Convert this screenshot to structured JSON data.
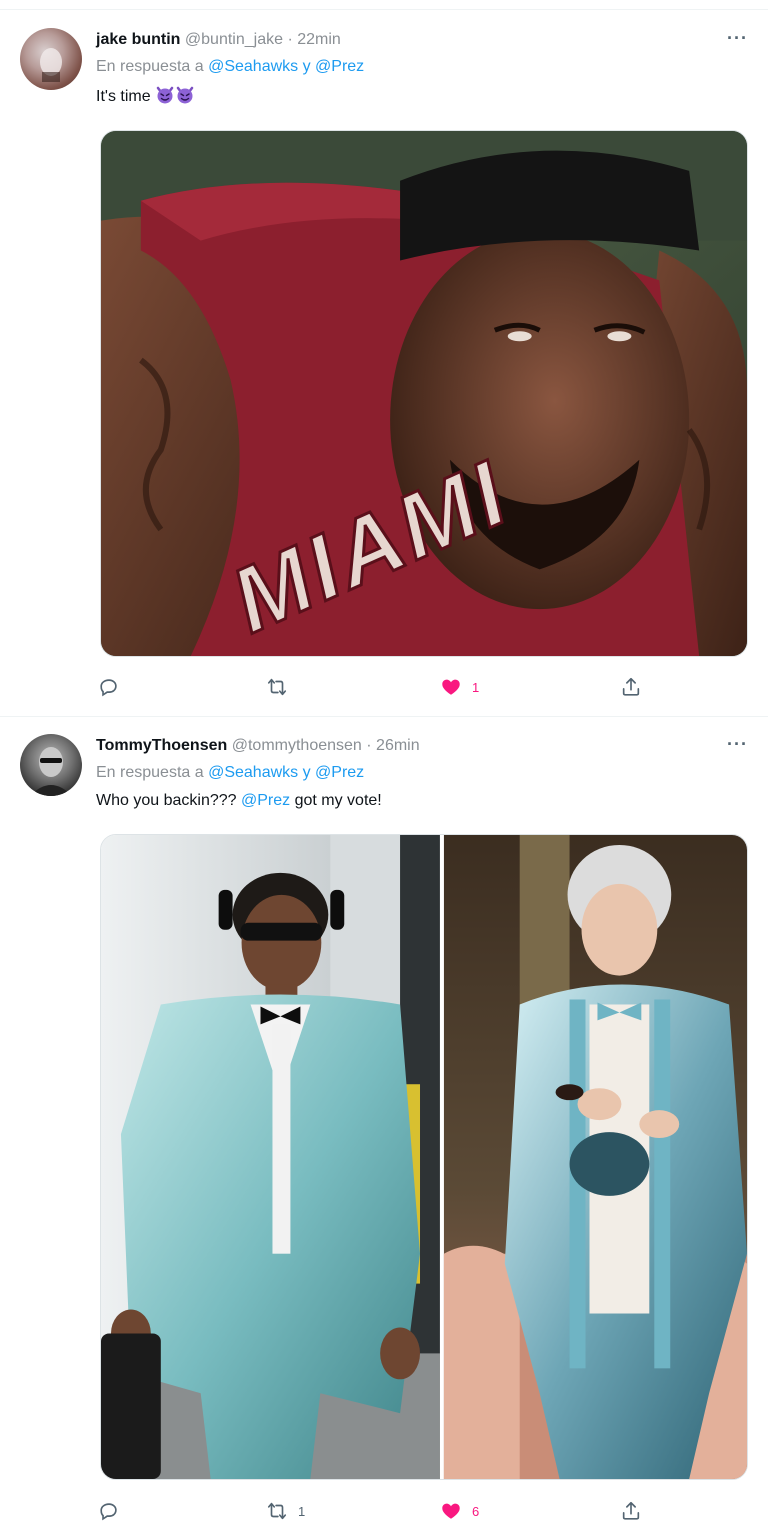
{
  "tweets": [
    {
      "display_name": "jake buntin",
      "handle": "@buntin_jake",
      "separator": "·",
      "time": "22min",
      "more_label": "···",
      "reply_prefix": "En respuesta a",
      "reply_mentions": "@Seahawks y @Prez",
      "text": "It's time",
      "emoji": [
        "smiling-imp-emoji",
        "smiling-imp-emoji"
      ],
      "media": {
        "description_icon": "photo",
        "jersey_text": "MIAMI"
      },
      "actions": {
        "reply_count": "",
        "retweet_count": "",
        "like_count": "1",
        "liked": true
      }
    },
    {
      "display_name": "TommyThoensen",
      "handle": "@tommythoensen",
      "separator": "·",
      "time": "26min",
      "more_label": "···",
      "reply_prefix": "En respuesta a",
      "reply_mentions": "@Seahawks y @Prez",
      "text_before": "Who you backin???",
      "text_mention": "@Prez",
      "text_after": "got my vote!",
      "media": {
        "description_icon": "photo"
      },
      "actions": {
        "reply_count": "",
        "retweet_count": "1",
        "like_count": "6",
        "liked": true
      }
    }
  ],
  "colors": {
    "accent": "#1d9bf0",
    "like": "#f91880",
    "muted": "#8a8f94",
    "text": "#0f1419"
  }
}
